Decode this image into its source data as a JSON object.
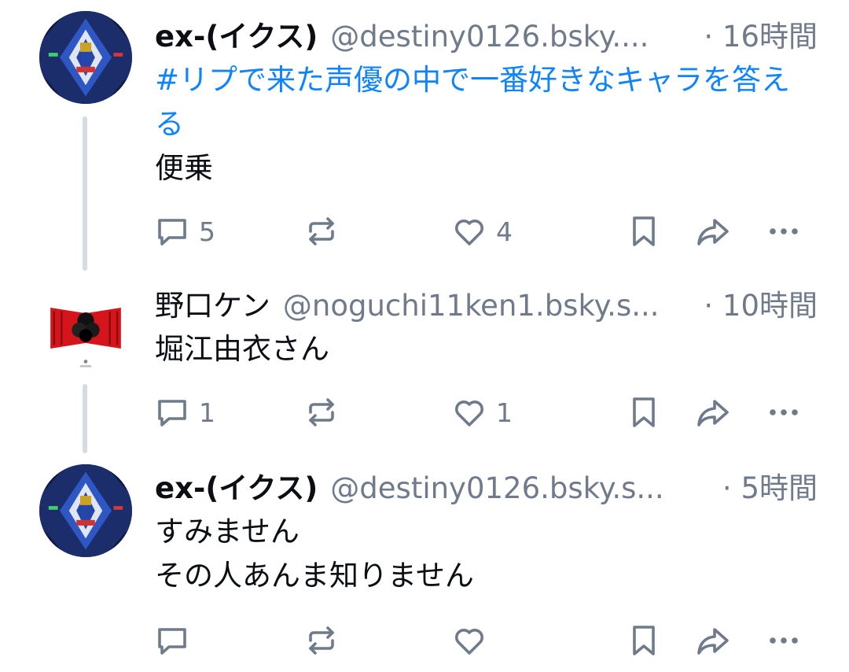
{
  "posts": [
    {
      "author": "ex-(イクス)",
      "handle": "@destiny0126.bsky....",
      "time": "· 16時間",
      "hashtag": "#リプで来た声優の中で一番好きなキャラを答える",
      "text_lines": [
        "便乗"
      ],
      "replies": "5",
      "likes": "4"
    },
    {
      "author": "野口ケン",
      "handle": "@noguchi11ken1.bsky.s...",
      "time": "· 10時間",
      "text_lines": [
        "堀江由衣さん"
      ],
      "replies": "1",
      "likes": "1"
    },
    {
      "author": "ex-(イクス)",
      "handle": "@destiny0126.bsky.s...",
      "time": "· 5時間",
      "text_lines": [
        "すみません",
        "その人あんま知りません"
      ],
      "replies": "",
      "likes": ""
    }
  ],
  "icons": {
    "reply": "reply-icon",
    "repost": "repost-icon",
    "like": "heart-icon",
    "bookmark": "bookmark-icon",
    "share": "share-icon",
    "more": "more-icon"
  },
  "colors": {
    "hashtag": "#1083fe",
    "secondary_text": "#6f7b8a",
    "thread_line": "#d4dbe2"
  }
}
